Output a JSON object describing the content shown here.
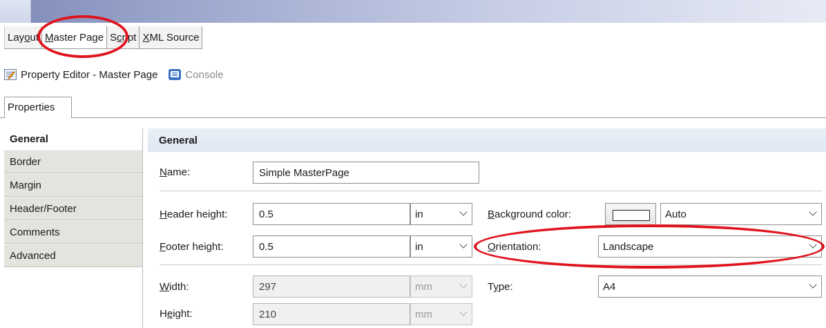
{
  "editor_tabs": [
    {
      "label": "Layout",
      "active": false
    },
    {
      "label": "Master Page",
      "active": true
    },
    {
      "label": "Script",
      "active": false
    },
    {
      "label": "XML Source",
      "active": false
    }
  ],
  "view_header": {
    "property_editor_label": "Property Editor - Master Page",
    "console_label": "Console"
  },
  "properties_tab": "Properties",
  "categories": [
    {
      "label": "General",
      "active": true
    },
    {
      "label": "Border",
      "active": false
    },
    {
      "label": "Margin",
      "active": false
    },
    {
      "label": "Header/Footer",
      "active": false
    },
    {
      "label": "Comments",
      "active": false
    },
    {
      "label": "Advanced",
      "active": false
    }
  ],
  "section_title": "General",
  "fields": {
    "name_label": "Name:",
    "name_value": "Simple MasterPage",
    "header_height_label": "Header height:",
    "header_height_value": "0.5",
    "header_height_unit": "in",
    "footer_height_label": "Footer height:",
    "footer_height_value": "0.5",
    "footer_height_unit": "in",
    "background_color_label": "Background color:",
    "background_color_value": "Auto",
    "orientation_label": "Orientation:",
    "orientation_value": "Landscape",
    "width_label": "Width:",
    "width_value": "297",
    "width_unit": "mm",
    "height_label": "Height:",
    "height_value": "210",
    "height_unit": "mm",
    "type_label": "Type:",
    "type_value": "A4"
  },
  "colors": {
    "annotation": "#e0141e",
    "header_bar": "#9aa5cc"
  },
  "icons": [
    "property-editor-icon",
    "console-icon",
    "chevron-down-icon"
  ]
}
